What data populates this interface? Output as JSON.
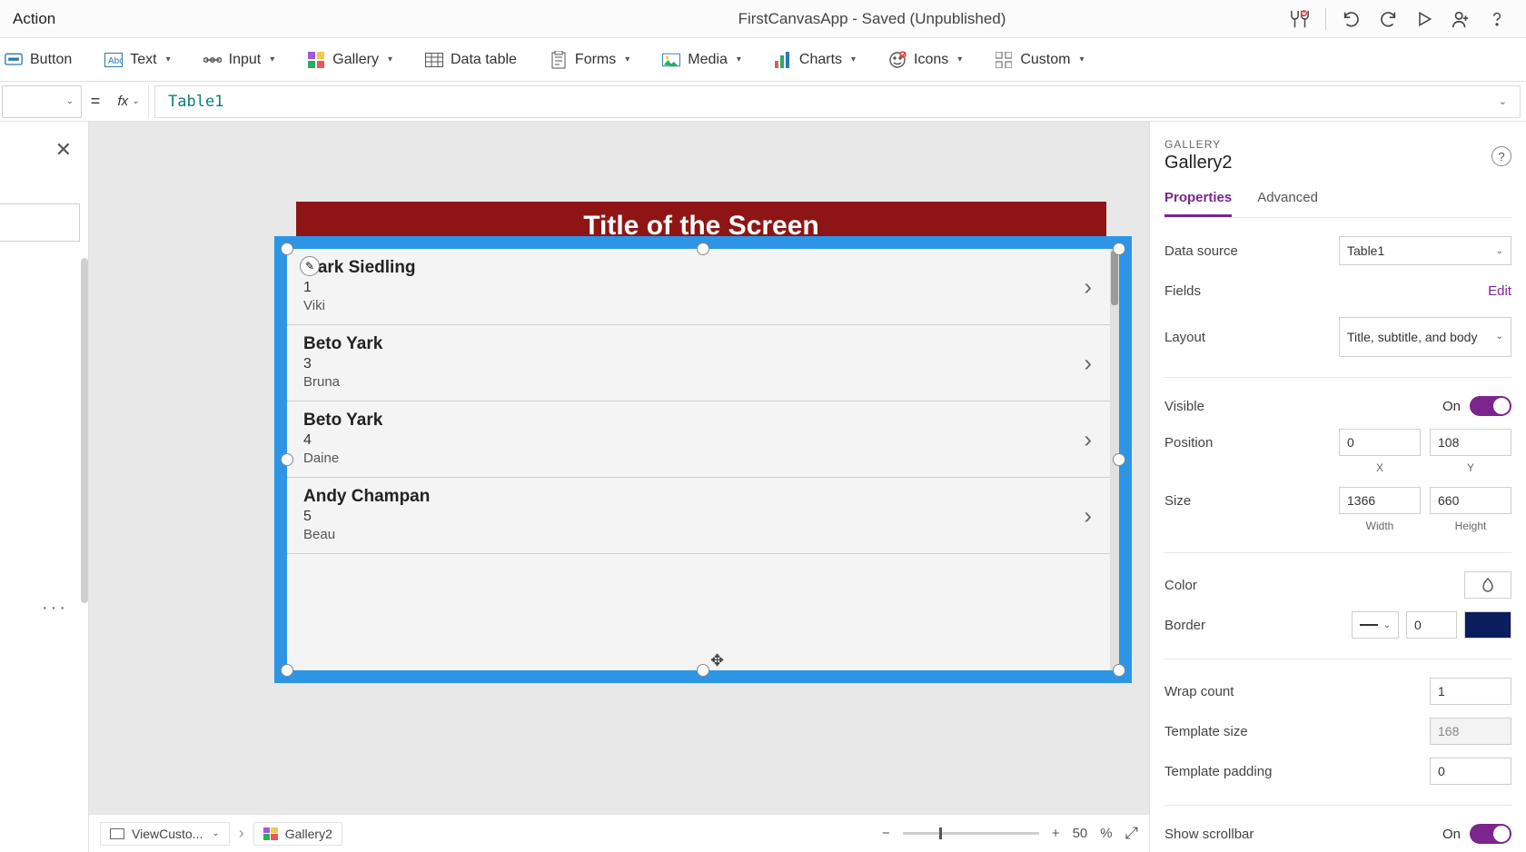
{
  "titlebar": {
    "left_action": "Action",
    "title": "FirstCanvasApp - Saved (Unpublished)"
  },
  "ribbon": {
    "button": "Button",
    "text": "Text",
    "input": "Input",
    "gallery": "Gallery",
    "datatable": "Data table",
    "forms": "Forms",
    "media": "Media",
    "charts": "Charts",
    "icons": "Icons",
    "custom": "Custom"
  },
  "formula": {
    "value": "Table1"
  },
  "screen": {
    "title": "Title of the Screen"
  },
  "gallery_items": [
    {
      "title": "Mark Siedling",
      "sub": "1",
      "body": "Viki"
    },
    {
      "title": "Beto Yark",
      "sub": "3",
      "body": "Bruna"
    },
    {
      "title": "Beto Yark",
      "sub": "4",
      "body": "Daine"
    },
    {
      "title": "Andy Champan",
      "sub": "5",
      "body": "Beau"
    }
  ],
  "right": {
    "kicker": "GALLERY",
    "name": "Gallery2",
    "tab_props": "Properties",
    "tab_adv": "Advanced",
    "datasource_label": "Data source",
    "datasource_value": "Table1",
    "fields_label": "Fields",
    "fields_edit": "Edit",
    "layout_label": "Layout",
    "layout_value": "Title, subtitle, and body",
    "visible_label": "Visible",
    "visible_value": "On",
    "position_label": "Position",
    "pos_x": "0",
    "pos_y": "108",
    "pos_x_lbl": "X",
    "pos_y_lbl": "Y",
    "size_label": "Size",
    "size_w": "1366",
    "size_h": "660",
    "size_w_lbl": "Width",
    "size_h_lbl": "Height",
    "color_label": "Color",
    "border_label": "Border",
    "border_val": "0",
    "wrap_label": "Wrap count",
    "wrap_val": "1",
    "tpl_size_label": "Template size",
    "tpl_size_val": "168",
    "tpl_pad_label": "Template padding",
    "tpl_pad_val": "0",
    "scroll_label": "Show scrollbar",
    "scroll_value": "On"
  },
  "breadcrumb": {
    "screen": "ViewCusto...",
    "control": "Gallery2"
  },
  "zoom": {
    "value": "50",
    "unit": "%"
  }
}
